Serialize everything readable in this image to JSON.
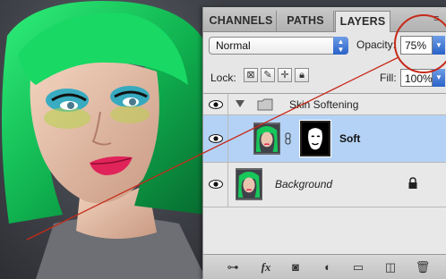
{
  "panel": {
    "tabs": [
      {
        "label": "CHANNELS"
      },
      {
        "label": "PATHS"
      },
      {
        "label": "LAYERS"
      }
    ],
    "active_tab": "LAYERS",
    "blend_mode": "Normal",
    "opacity_label": "Opacity:",
    "opacity_value": "75%",
    "lock_label": "Lock:",
    "fill_label": "Fill:",
    "fill_value": "100%",
    "layers": [
      {
        "name": "Skin Softening",
        "type": "group"
      },
      {
        "name": "Soft",
        "type": "layer",
        "selected": true
      },
      {
        "name": "Background",
        "type": "background",
        "locked": true
      }
    ],
    "bottom_icons": [
      "link-icon",
      "fx-icon",
      "mask-icon",
      "adjustment-icon",
      "group-icon",
      "new-layer-icon",
      "trash-icon"
    ]
  },
  "colors": {
    "annotation": "#c62a1a",
    "selected_row": "#b4d2f5",
    "hair": "#16c25a",
    "lips": "#e0245a"
  }
}
